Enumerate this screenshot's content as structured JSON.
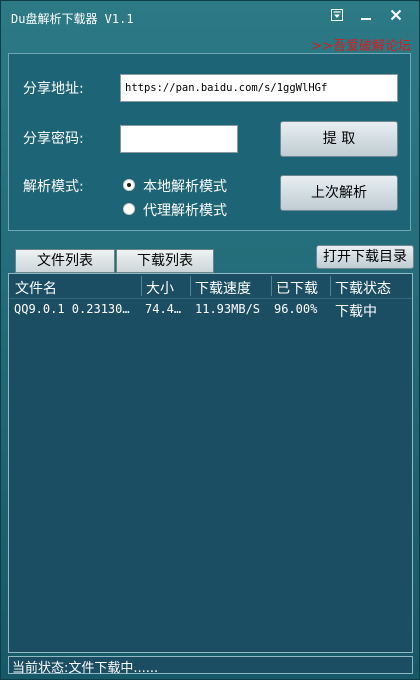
{
  "window": {
    "title": "Du盘解析下载器 V1.1",
    "forum_link": ">>吾爱破解论坛"
  },
  "form": {
    "share_url_label": "分享地址:",
    "share_url_value": "https://pan.baidu.com/s/1ggWlHGf",
    "share_pwd_label": "分享密码:",
    "share_pwd_value": "",
    "extract_button": "提  取",
    "mode_label": "解析模式:",
    "mode_local": "本地解析模式",
    "mode_proxy": "代理解析模式",
    "selected_mode": "local",
    "last_parse_button": "上次解析"
  },
  "tabs": {
    "file_list": "文件列表",
    "download_list": "下载列表",
    "open_dir_button": "打开下载目录"
  },
  "table": {
    "headers": [
      "文件名",
      "大小",
      "下载速度",
      "已下载",
      "下载状态"
    ],
    "rows": [
      [
        "QQ9.0.1 0.23130…",
        "74.4…",
        "11.93MB/S",
        "96.00%",
        "下载中"
      ]
    ]
  },
  "status": {
    "text": "当前状态:文件下载中......"
  },
  "colors": {
    "window_bg": "#1d6476",
    "forum_link": "#d41e1e",
    "list_bg": "#1b4e63"
  },
  "icons": {
    "menu": "menu-dropdown-icon",
    "minimize": "minimize-icon",
    "close": "close-icon"
  }
}
